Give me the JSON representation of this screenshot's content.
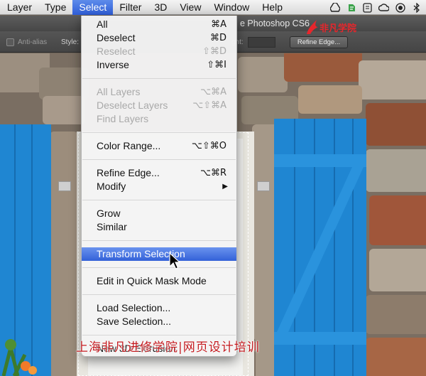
{
  "menubar": {
    "items": [
      "Layer",
      "Type",
      "Select",
      "Filter",
      "3D",
      "View",
      "Window",
      "Help"
    ],
    "active": "Select"
  },
  "window": {
    "title": "e Photoshop CS6"
  },
  "logo": {
    "text": "非凡学院"
  },
  "options": {
    "anti_alias": "Anti-alias",
    "style": "Style:",
    "height": "ght:",
    "refine_edge": "Refine Edge..."
  },
  "menu": {
    "groups": [
      [
        {
          "label": "All",
          "shortcut": "⌘A",
          "enabled": true
        },
        {
          "label": "Deselect",
          "shortcut": "⌘D",
          "enabled": true
        },
        {
          "label": "Reselect",
          "shortcut": "⇧⌘D",
          "enabled": false
        },
        {
          "label": "Inverse",
          "shortcut": "⇧⌘I",
          "enabled": true
        }
      ],
      [
        {
          "label": "All Layers",
          "shortcut": "⌥⌘A",
          "enabled": false
        },
        {
          "label": "Deselect Layers",
          "shortcut": "⌥⇧⌘A",
          "enabled": false
        },
        {
          "label": "Find Layers",
          "shortcut": "",
          "enabled": false
        }
      ],
      [
        {
          "label": "Color Range...",
          "shortcut": "⌥⇧⌘O",
          "enabled": true
        }
      ],
      [
        {
          "label": "Refine Edge...",
          "shortcut": "⌥⌘R",
          "enabled": true
        },
        {
          "label": "Modify",
          "shortcut": "",
          "enabled": true,
          "submenu": true
        }
      ],
      [
        {
          "label": "Grow",
          "shortcut": "",
          "enabled": true
        },
        {
          "label": "Similar",
          "shortcut": "",
          "enabled": true
        }
      ],
      [
        {
          "label": "Transform Selection",
          "shortcut": "",
          "enabled": true,
          "highlighted": true
        }
      ],
      [
        {
          "label": "Edit in Quick Mask Mode",
          "shortcut": "",
          "enabled": true
        }
      ],
      [
        {
          "label": "Load Selection...",
          "shortcut": "",
          "enabled": true
        },
        {
          "label": "Save Selection...",
          "shortcut": "",
          "enabled": true
        }
      ],
      [
        {
          "label": "New 3D Extrusion",
          "shortcut": "",
          "enabled": true
        }
      ]
    ]
  },
  "watermark": "上海非凡进修学院|网页设计培训",
  "colors": {
    "menu_highlight": "#3b6ad9",
    "shutter_blue": "#1f86d2",
    "logo_red": "#e8262c"
  }
}
